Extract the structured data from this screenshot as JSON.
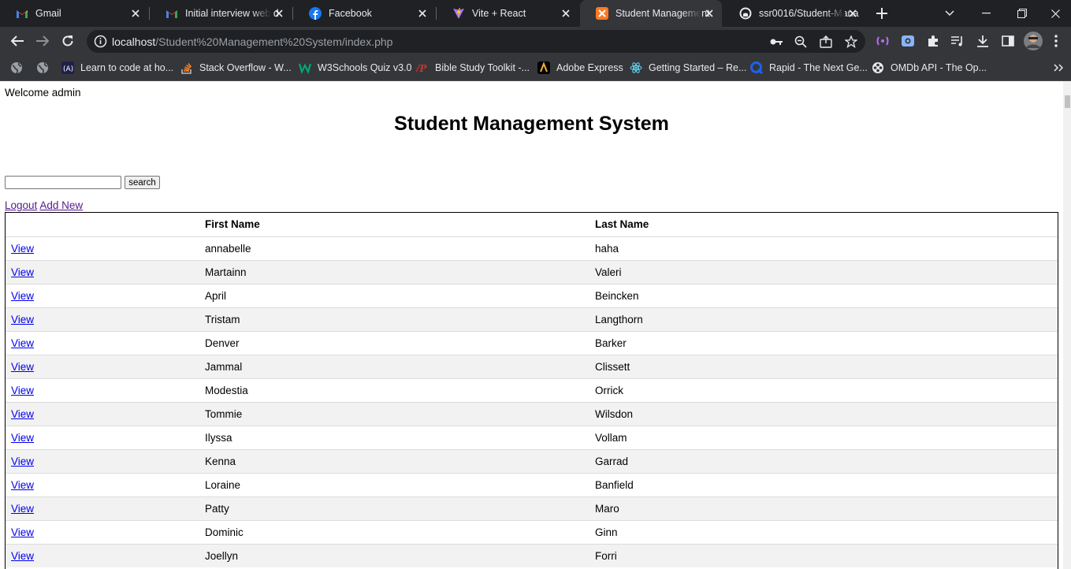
{
  "tabs": [
    {
      "title": "Gmail",
      "icon": "gmail-icon"
    },
    {
      "title": "Initial interview web d",
      "icon": "gmail-icon"
    },
    {
      "title": "Facebook",
      "icon": "facebook-icon"
    },
    {
      "title": "Vite + React",
      "icon": "vite-icon"
    },
    {
      "title": "Student Management",
      "icon": "xampp-icon",
      "active": true
    },
    {
      "title": "ssr0016/Student-Mana",
      "icon": "github-icon"
    }
  ],
  "address": {
    "host": "localhost",
    "path": "/Student%20Management%20System/index.php"
  },
  "bookmarks": [
    {
      "label": "Learn to code at ho...",
      "icon": "codecademy-icon"
    },
    {
      "label": "Stack Overflow - W...",
      "icon": "stackoverflow-icon"
    },
    {
      "label": "W3Schools Quiz v3.0",
      "icon": "w3schools-icon"
    },
    {
      "label": "Bible Study Toolkit -...",
      "icon": "bible-icon"
    },
    {
      "label": "Adobe Express",
      "icon": "adobe-icon"
    },
    {
      "label": "Getting Started – Re...",
      "icon": "react-icon"
    },
    {
      "label": "Rapid - The Next Ge...",
      "icon": "rapid-icon"
    },
    {
      "label": "OMDb API - The Op...",
      "icon": "omdb-icon"
    }
  ],
  "page": {
    "welcome": "Welcome admin",
    "title": "Student Management System",
    "search_value": "",
    "search_button": "search",
    "logout_link": "Logout",
    "add_new_link": "Add New",
    "columns": [
      "",
      "First Name",
      "Last Name"
    ],
    "view_label": "View",
    "rows": [
      {
        "first": "annabelle",
        "last": "haha"
      },
      {
        "first": "Martainn",
        "last": "Valeri"
      },
      {
        "first": "April",
        "last": "Beincken"
      },
      {
        "first": "Tristam",
        "last": "Langthorn"
      },
      {
        "first": "Denver",
        "last": "Barker"
      },
      {
        "first": "Jammal",
        "last": "Clissett"
      },
      {
        "first": "Modestia",
        "last": "Orrick"
      },
      {
        "first": "Tommie",
        "last": "Wilsdon"
      },
      {
        "first": "Ilyssa",
        "last": "Vollam"
      },
      {
        "first": "Kenna",
        "last": "Garrad"
      },
      {
        "first": "Loraine",
        "last": "Banfield"
      },
      {
        "first": "Patty",
        "last": "Maro"
      },
      {
        "first": "Dominic",
        "last": "Ginn"
      },
      {
        "first": "Joellyn",
        "last": "Forri"
      }
    ]
  },
  "colors": {
    "chrome_dark": "#202124",
    "chrome_toolbar": "#35363a",
    "link": "#0000ee",
    "visited_link": "#551a8b",
    "row_alt": "#f2f2f2"
  }
}
